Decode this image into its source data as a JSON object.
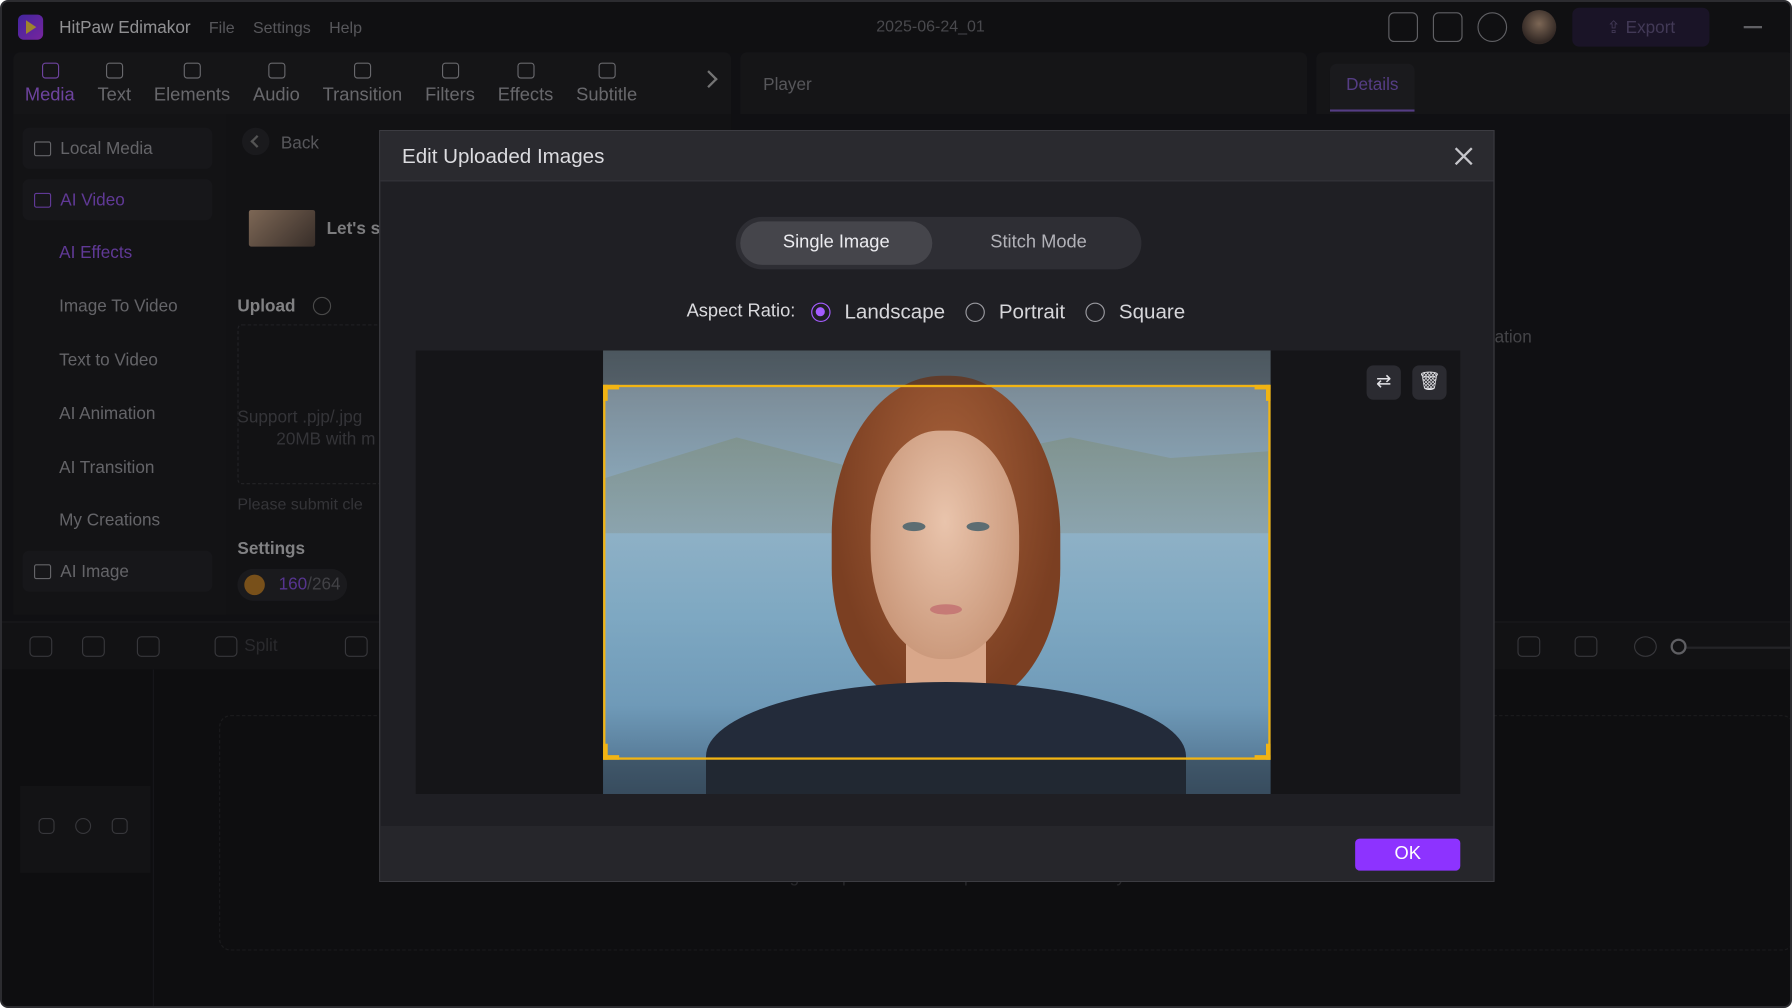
{
  "titlebar": {
    "app_name": "HitPaw Edimakor",
    "menu": [
      "File",
      "Settings",
      "Help"
    ],
    "doc_title": "2025-06-24_01",
    "export_label": "Export"
  },
  "toolbar": {
    "tools": [
      "Media",
      "Text",
      "Elements",
      "Audio",
      "Transition",
      "Filters",
      "Effects",
      "Subtitle"
    ]
  },
  "player": {
    "label": "Player"
  },
  "details": {
    "tab": "Details",
    "partial_text": "ation"
  },
  "left_nav": {
    "local_media": "Local Media",
    "ai_video": "AI Video",
    "items": [
      "AI Effects",
      "Image To Video",
      "Text to Video",
      "AI Animation",
      "AI Transition",
      "My Creations"
    ],
    "ai_image": "AI Image"
  },
  "mid_panel": {
    "back": "Back",
    "lets": "Let's s",
    "upload": "Upload",
    "support_line1": "Support .pjp/.jpg",
    "support_line2": "20MB with m",
    "submit": "Please submit cle",
    "settings": "Settings",
    "credits_used": "160",
    "credits_total": "/264"
  },
  "timeline": {
    "split": "Split",
    "drag_text": "Drag or import videos and photos here to start your video!"
  },
  "modal": {
    "title": "Edit Uploaded Images",
    "mode_single": "Single Image",
    "mode_stitch": "Stitch Mode",
    "aspect_label": "Aspect Ratio:",
    "aspect_options": [
      "Landscape",
      "Portrait",
      "Square"
    ],
    "aspect_selected": "Landscape",
    "ok": "OK"
  },
  "colors": {
    "accent": "#8d33ff",
    "crop_frame": "#f2b413",
    "active_tab": "#b06cff"
  }
}
